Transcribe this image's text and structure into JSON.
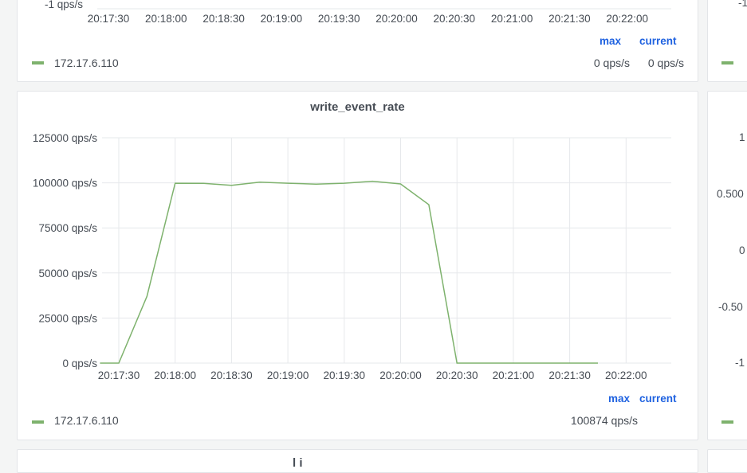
{
  "top_panel": {
    "y_tick_partial": "-1 qps/s",
    "x_ticks": [
      "20:17:30",
      "20:18:00",
      "20:18:30",
      "20:19:00",
      "20:19:30",
      "20:20:00",
      "20:20:30",
      "20:21:00",
      "20:21:30",
      "20:22:00"
    ],
    "legend": {
      "max_header": "max",
      "current_header": "current",
      "series_name": "172.17.6.110",
      "max_value": "0 qps/s",
      "current_value": "0 qps/s"
    }
  },
  "main_panel": {
    "title": "write_event_rate",
    "legend": {
      "max_header": "max",
      "current_header": "current",
      "series_name": "172.17.6.110",
      "max_value": "100874 qps/s",
      "current_value": ""
    }
  },
  "right_panel": {
    "top_tick_partial": "-1",
    "main_ticks": [
      "1",
      "0.500",
      "0",
      "-0.50",
      "-1"
    ]
  },
  "bottom_panel": {
    "title_partial": "l i"
  },
  "colors": {
    "series": "#7eb26d",
    "legend_header": "#1f62e0"
  },
  "chart_data": {
    "type": "line",
    "title": "write_event_rate",
    "x": [
      "20:17:20",
      "20:17:30",
      "20:17:45",
      "20:18:00",
      "20:18:15",
      "20:18:30",
      "20:18:45",
      "20:19:00",
      "20:19:15",
      "20:19:30",
      "20:19:45",
      "20:20:00",
      "20:20:15",
      "20:20:30",
      "20:20:45",
      "20:21:00",
      "20:21:15",
      "20:21:30",
      "20:21:45"
    ],
    "x_ticks": [
      "20:17:30",
      "20:18:00",
      "20:18:30",
      "20:19:00",
      "20:19:30",
      "20:20:00",
      "20:20:30",
      "20:21:00",
      "20:21:30",
      "20:22:00"
    ],
    "y_ticks": [
      "125000 qps/s",
      "100000 qps/s",
      "75000 qps/s",
      "50000 qps/s",
      "25000 qps/s",
      "0 qps/s"
    ],
    "ylim": [
      0,
      125000
    ],
    "grid": true,
    "legend": "bottom-left",
    "series": [
      {
        "name": "172.17.6.110",
        "values": [
          0,
          0,
          37000,
          99800,
          99700,
          98600,
          100400,
          99800,
          99300,
          99800,
          100874,
          99400,
          87900,
          0,
          0,
          0,
          0,
          0,
          0
        ]
      }
    ]
  }
}
